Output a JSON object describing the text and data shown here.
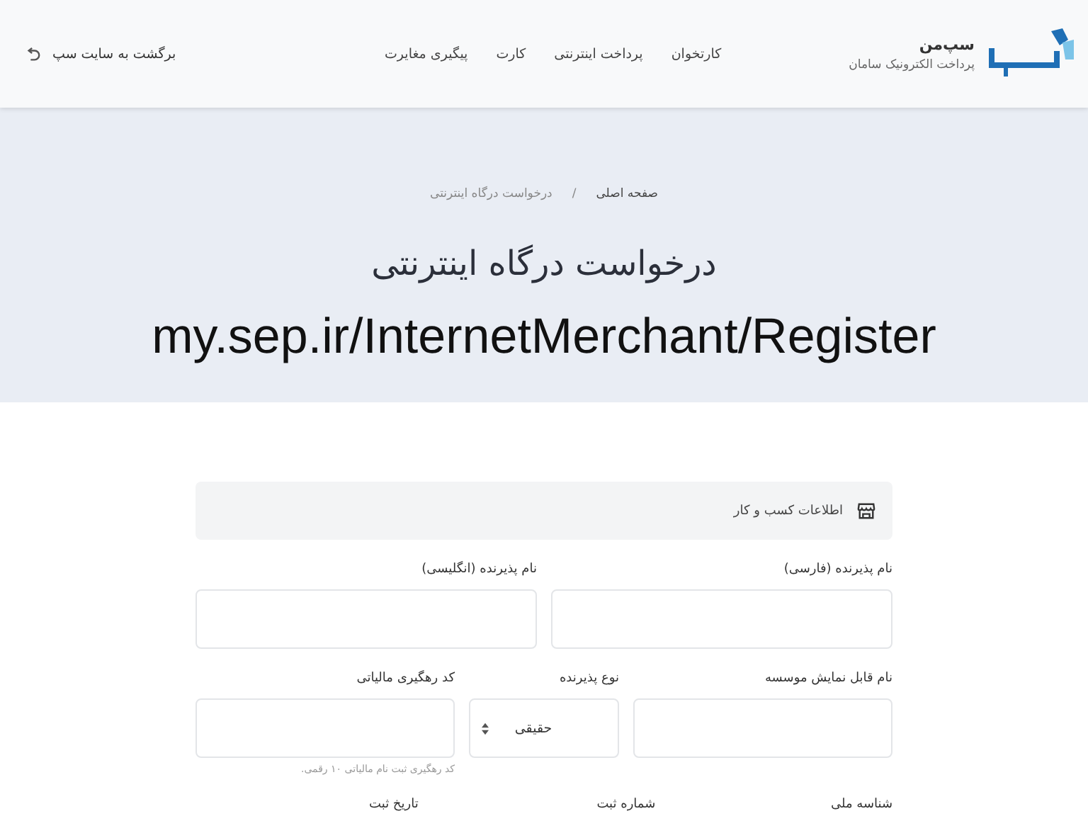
{
  "header": {
    "brand": {
      "name": "سپ‌من",
      "subtitle": "پرداخت الکترونیک سامان"
    },
    "nav": [
      {
        "label": "کارتخوان"
      },
      {
        "label": "پرداخت اینترنتی"
      },
      {
        "label": "کارت"
      },
      {
        "label": "پیگیری مغایرت"
      }
    ],
    "back_link": "برگشت به سایت سپ"
  },
  "hero": {
    "breadcrumb": [
      "صفحه اصلی",
      "/",
      "درخواست درگاه اینترنتی"
    ],
    "title": "درخواست درگاه اینترنتی",
    "url_caption": "my.sep.ir/InternetMerchant/Register"
  },
  "form": {
    "section_title": "اطلاعات کسب و کار",
    "rows": [
      [
        {
          "kind": "input",
          "label": "نام پذیرنده (فارسی)"
        },
        {
          "kind": "input",
          "label": "نام پذیرنده (انگلیسی)"
        }
      ],
      [
        {
          "kind": "input",
          "label": "نام قابل نمایش موسسه"
        },
        {
          "kind": "select",
          "label": "نوع پذیرنده",
          "value": "حقیقی"
        },
        {
          "kind": "input",
          "label": "کد رهگیری مالیاتی",
          "hint": "کد رهگیری ثبت نام مالیاتی ۱۰ رقمی."
        }
      ],
      [
        {
          "kind": "label",
          "label": "شناسه ملی"
        },
        {
          "kind": "label",
          "label": "شماره ثبت"
        },
        {
          "kind": "label",
          "label": "تاریخ ثبت"
        }
      ]
    ]
  }
}
